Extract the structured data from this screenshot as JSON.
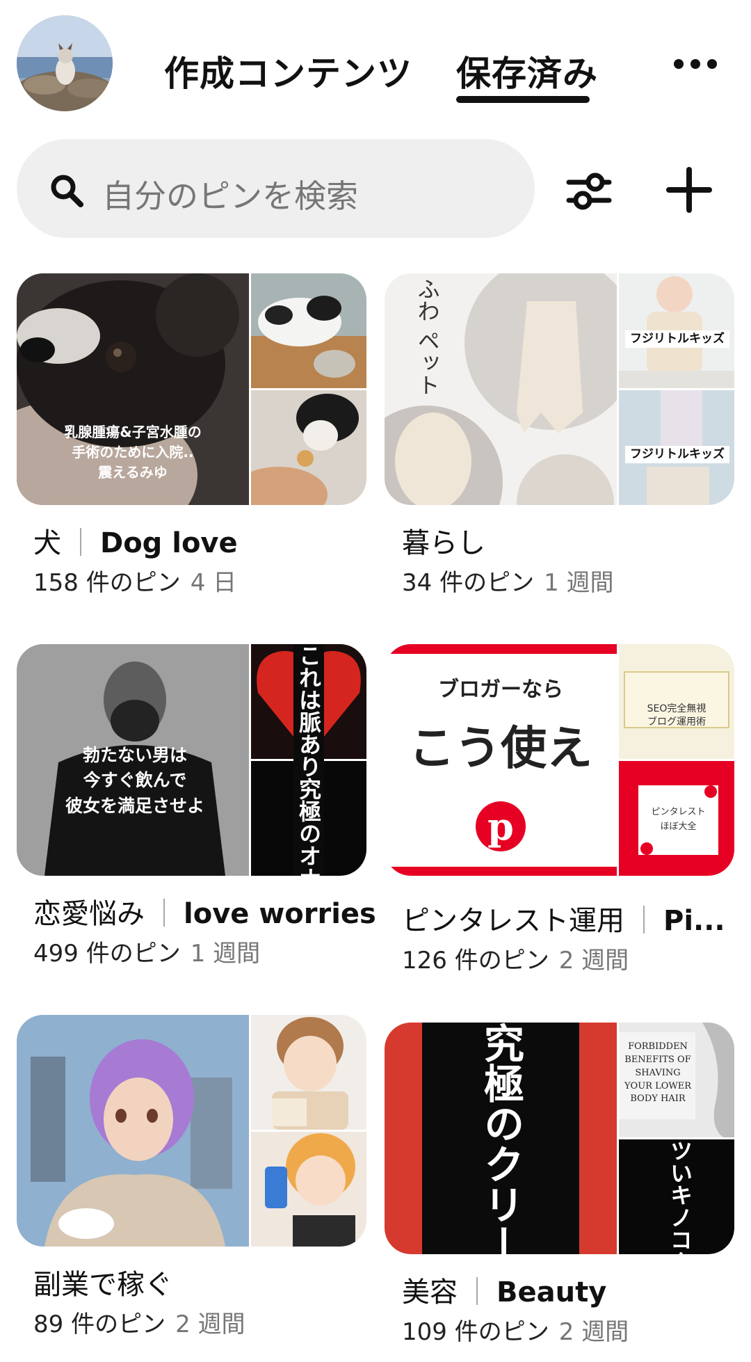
{
  "header": {
    "tab_created": "作成コンテンツ",
    "tab_saved": "保存済み",
    "active_tab": "tab_saved"
  },
  "search": {
    "placeholder": "自分のピンを検索"
  },
  "colors": {
    "text_primary": "#111111",
    "text_secondary": "#767676",
    "search_bg": "#efefef",
    "pinterest_red": "#e60023"
  },
  "icons": [
    "search-icon",
    "filter-icon",
    "plus-icon",
    "more-icon"
  ],
  "boards": [
    {
      "title": "犬",
      "title_en": "Dog love",
      "count": "158 件のピン",
      "age": "4 日",
      "overlay_text": [
        "乳腺腫瘍&子宮水腫の",
        "手術のために入院..",
        "震えるみゆ"
      ]
    },
    {
      "title": "暮らし",
      "title_en": "",
      "count": "34 件のピン",
      "age": "1 週間",
      "overlay_text": [
        "ふわ",
        "ペット",
        "フジリトルキッズ",
        "フジリトルキッズ"
      ]
    },
    {
      "title": "恋愛悩み",
      "title_en": "love worries",
      "count": "499 件のピン",
      "age": "1 週間",
      "overlay_text": [
        "勃たない男は",
        "今すぐ飲んで",
        "彼女を満足させよ",
        "これは脈あり究極のオナ"
      ]
    },
    {
      "title": "ピンタレスト運用",
      "title_en": "Pi...",
      "count": "126 件のピン",
      "age": "2 週間",
      "overlay_text": [
        "ブロガーなら",
        "こう使え",
        "SEO完全無視",
        "ブログ運用術",
        "ピンタレスト",
        "ほぼ大全"
      ]
    },
    {
      "title": "副業で稼ぐ",
      "title_en": "",
      "count": "89 件のピン",
      "age": "2 週間",
      "overlay_text": []
    },
    {
      "title": "美容",
      "title_en": "Beauty",
      "count": "109 件のピン",
      "age": "2 週間",
      "overlay_text": [
        "究極のクリー",
        "FORBIDDEN",
        "BENEFITS OF",
        "SHAVING",
        "YOUR LOWER",
        "BODY HAIR",
        "ツいキノコクリ"
      ]
    }
  ]
}
